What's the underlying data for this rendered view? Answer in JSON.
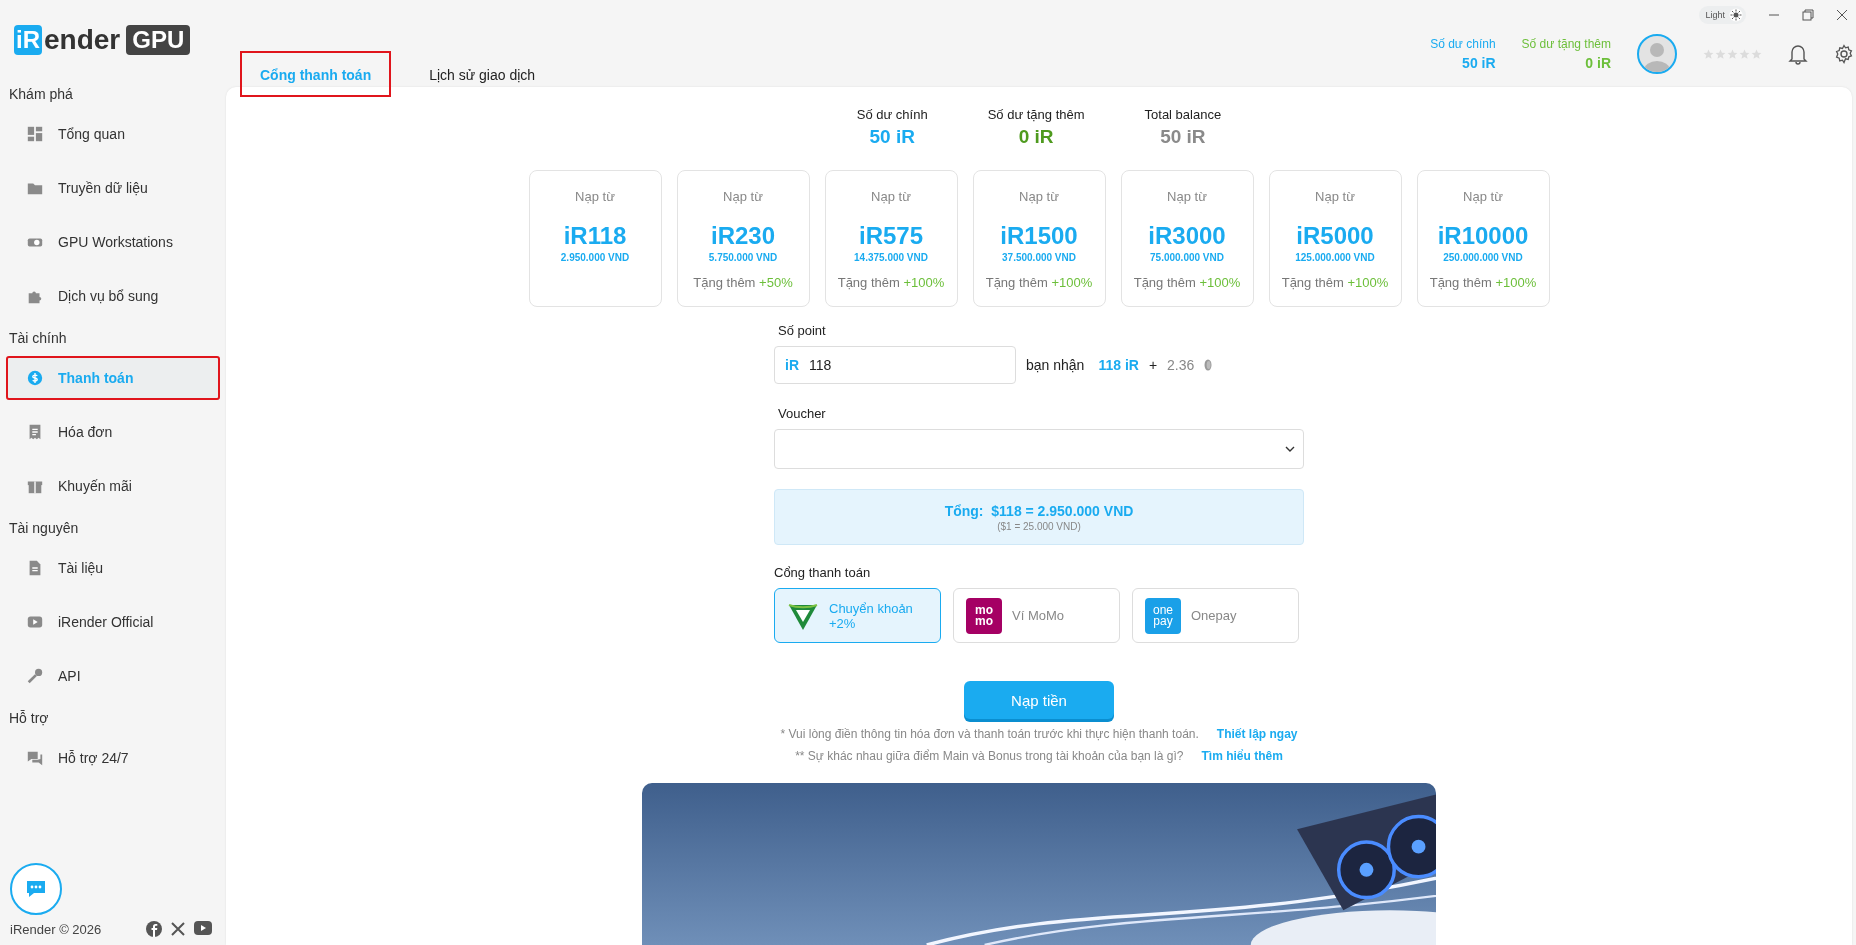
{
  "logo": {
    "mark": "iR",
    "word": "ender",
    "badge": "GPU"
  },
  "sidebar": {
    "sections": [
      {
        "title": "Khám phá",
        "items": [
          {
            "label": "Tổng quan",
            "kind": "grid",
            "selected": false,
            "outlined": false
          },
          {
            "label": "Truyền dữ liệu",
            "kind": "folder",
            "selected": false,
            "outlined": false
          },
          {
            "label": "GPU Workstations",
            "kind": "gpu",
            "selected": false,
            "outlined": false
          },
          {
            "label": "Dịch vụ bổ sung",
            "kind": "puzzle",
            "selected": false,
            "outlined": false
          }
        ]
      },
      {
        "title": "Tài chính",
        "items": [
          {
            "label": "Thanh toán",
            "kind": "dollar",
            "selected": true,
            "outlined": true
          },
          {
            "label": "Hóa đơn",
            "kind": "receipt",
            "selected": false,
            "outlined": false
          },
          {
            "label": "Khuyến mãi",
            "kind": "gift",
            "selected": false,
            "outlined": false
          }
        ]
      },
      {
        "title": "Tài nguyên",
        "items": [
          {
            "label": "Tài liệu",
            "kind": "doc",
            "selected": false,
            "outlined": false
          },
          {
            "label": "iRender Official",
            "kind": "video",
            "selected": false,
            "outlined": false
          },
          {
            "label": "API",
            "kind": "key",
            "selected": false,
            "outlined": false
          }
        ]
      },
      {
        "title": "Hỗ trợ",
        "items": [
          {
            "label": "Hỗ trợ 24/7",
            "kind": "chat",
            "selected": false,
            "outlined": false
          }
        ]
      }
    ],
    "footer": "iRender © 2026"
  },
  "theme_toggle": {
    "label": "Light"
  },
  "header_balances": [
    {
      "label": "Số dư chính",
      "value": "50 iR",
      "color": "#1aabf0"
    },
    {
      "label": "Số dư tặng thêm",
      "value": "0 iR",
      "color": "#6cbf3a"
    }
  ],
  "rating": {
    "stars": 0
  },
  "tabs": [
    {
      "label": "Cổng thanh toán",
      "selected": true,
      "outlined": true
    },
    {
      "label": "Lịch sử giao dịch",
      "selected": false,
      "outlined": false
    }
  ],
  "balances": [
    {
      "label": "Số dư chính",
      "value": "50 iR",
      "color": "#1aabf0"
    },
    {
      "label": "Số dư tặng thêm",
      "value": "0 iR",
      "color": "#4e9a1e"
    },
    {
      "label": "Total balance",
      "value": "50 iR",
      "color": "#8a8a8a"
    }
  ],
  "packages": [
    {
      "caption": "Nạp từ",
      "amount": "iR118",
      "vnd": "2.950.000 VND"
    },
    {
      "caption": "Nạp từ",
      "amount": "iR230",
      "vnd": "5.750.000 VND",
      "bonus_label": "Tặng thêm",
      "bonus": "+50%"
    },
    {
      "caption": "Nạp từ",
      "amount": "iR575",
      "vnd": "14.375.000 VND",
      "bonus_label": "Tặng thêm",
      "bonus": "+100%"
    },
    {
      "caption": "Nạp từ",
      "amount": "iR1500",
      "vnd": "37.500.000 VND",
      "bonus_label": "Tặng thêm",
      "bonus": "+100%"
    },
    {
      "caption": "Nạp từ",
      "amount": "iR3000",
      "vnd": "75.000.000 VND",
      "bonus_label": "Tặng thêm",
      "bonus": "+100%"
    },
    {
      "caption": "Nạp từ",
      "amount": "iR5000",
      "vnd": "125.000.000 VND",
      "bonus_label": "Tặng thêm",
      "bonus": "+100%"
    },
    {
      "caption": "Nạp từ",
      "amount": "iR10000",
      "vnd": "250.000.000 VND",
      "bonus_label": "Tặng thêm",
      "bonus": "+100%"
    }
  ],
  "points": {
    "label": "Số point",
    "prefix": "iR",
    "value": "118",
    "receive_label": "bạn nhận",
    "receive": "118 iR",
    "plus": "+",
    "bonus": "2.36"
  },
  "voucher": {
    "label": "Voucher"
  },
  "total": {
    "label": "Tổng:",
    "amount": "$118 = 2.950.000 VND",
    "rate": "($1 = 25.000 VND)"
  },
  "gateway": {
    "label": "Cổng thanh toán",
    "options": [
      {
        "kind": "bank",
        "name": "Chuyển khoản",
        "note": "+2%",
        "selected": true
      },
      {
        "kind": "momo",
        "logo_lines": [
          "mo",
          "mo"
        ],
        "name": "Ví MoMo",
        "selected": false
      },
      {
        "kind": "onepay",
        "logo_lines": [
          "one",
          "pay"
        ],
        "name": "Onepay",
        "selected": false
      }
    ]
  },
  "submit": "Nạp tiền",
  "notes": [
    {
      "text": "* Vui lòng điền thông tin hóa đơn và thanh toán trước khi thực hiện thanh toán.",
      "link": "Thiết lập ngay"
    },
    {
      "text": "** Sự khác nhau giữa điểm Main và Bonus trong tài khoản của bạn là gì?",
      "link": "Tìm hiểu thêm"
    }
  ]
}
